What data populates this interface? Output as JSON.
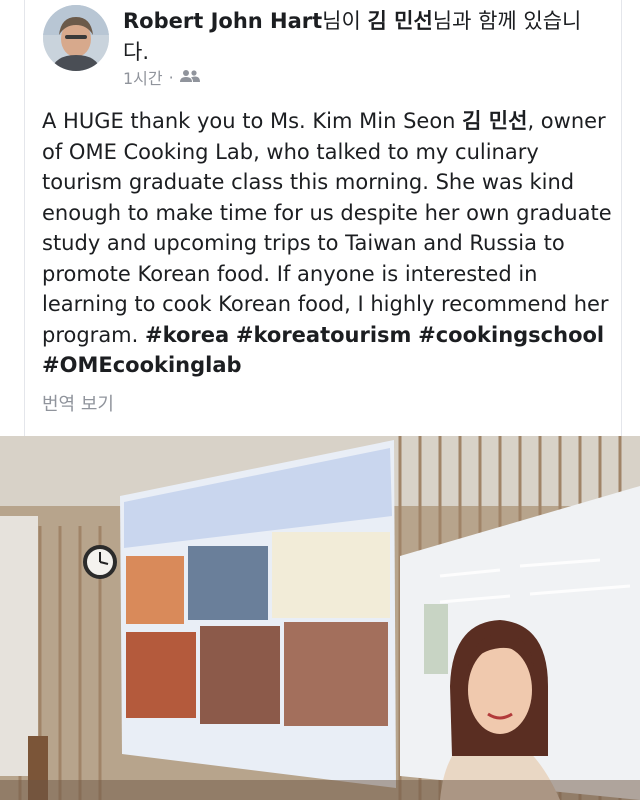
{
  "post": {
    "author": "Robert John Hart",
    "with_prefix": "님이 ",
    "tagged": "김 민선",
    "with_suffix": "님과 함께 있습니다.",
    "time": "1시간",
    "dot": "·",
    "audience_icon": "friends-icon",
    "text_intro": "A HUGE thank you to Ms. Kim Min Seon ",
    "text_ko": "김 민선",
    "text_body": ", owner of OME Cooking Lab, who talked to my culinary tourism graduate class this morning. She was kind enough to make time for us despite her own graduate study and upcoming trips to Taiwan and Russia to promote Korean food. If anyone is interested in learning to cook Korean food, I highly recommend her program. ",
    "hashtags": [
      "#korea",
      "#koreatourism",
      "#cookingschool",
      "#OMEcookinglab"
    ],
    "translate_label": "번역 보기"
  },
  "photo": {
    "description_icon": "classroom-photo"
  }
}
